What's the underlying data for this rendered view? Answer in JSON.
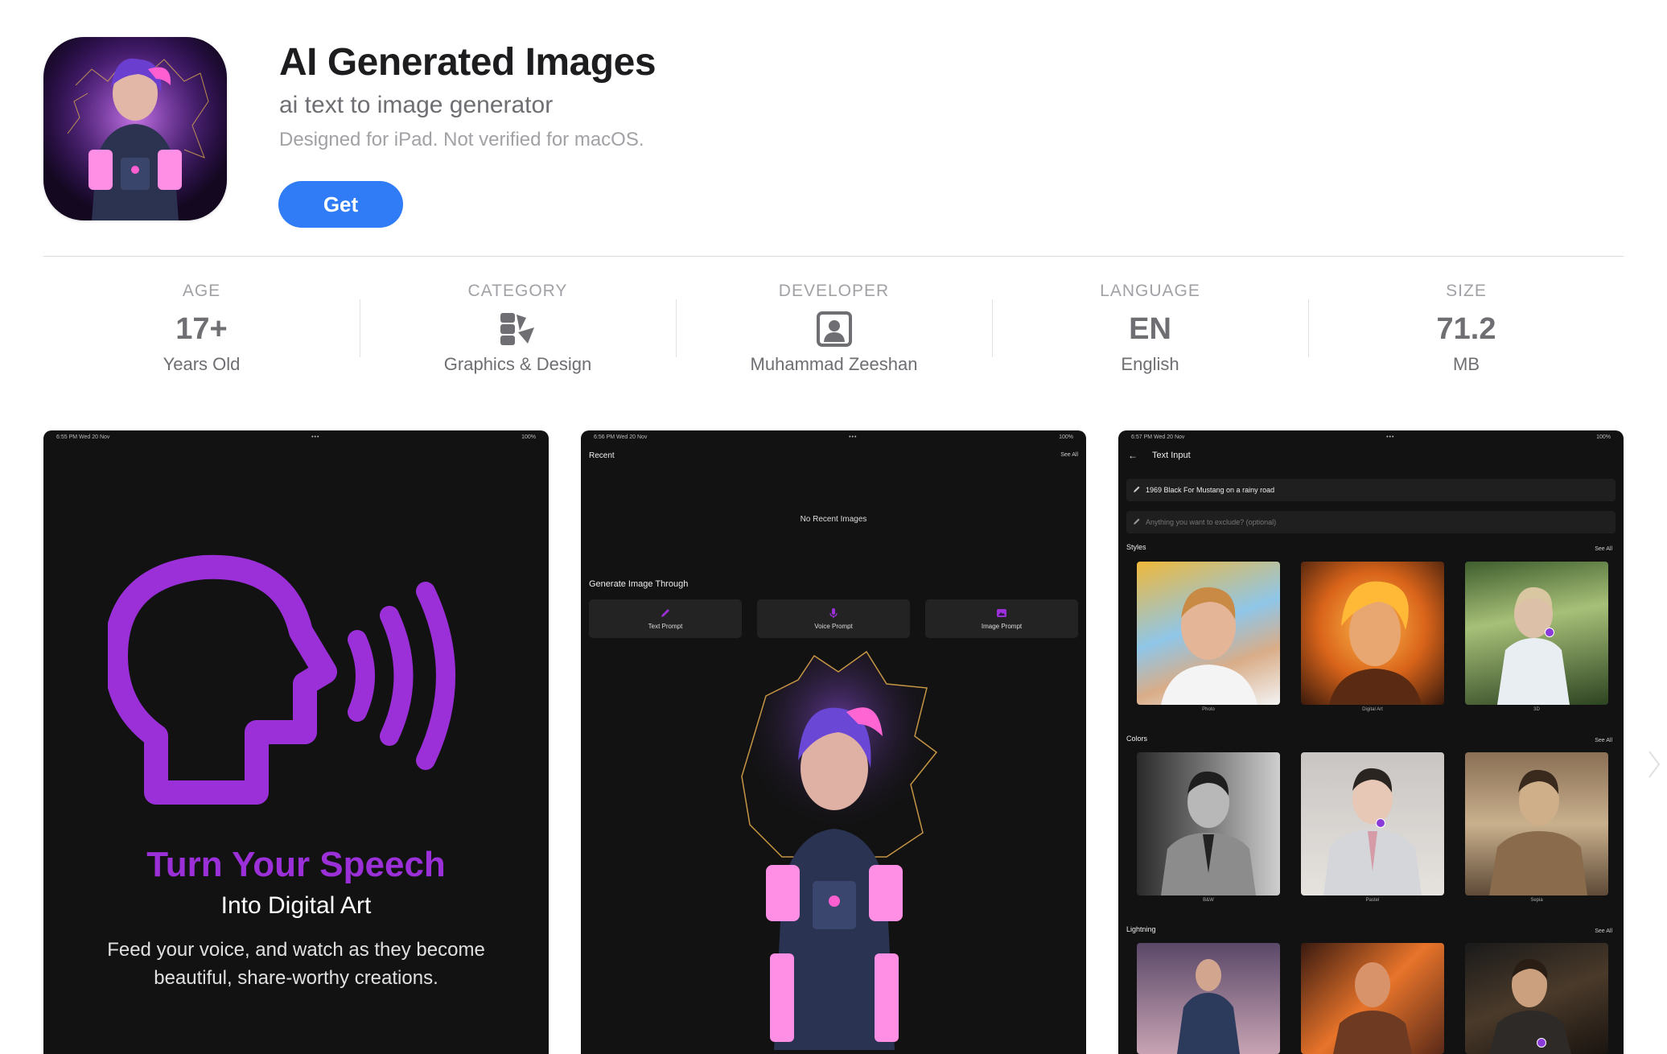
{
  "app": {
    "title": "AI Generated Images",
    "subtitle": "ai text to image generator",
    "note": "Designed for iPad. Not verified for macOS.",
    "get_label": "Get"
  },
  "info": [
    {
      "label": "AGE",
      "value": "17+",
      "sub": "Years Old"
    },
    {
      "label": "CATEGORY",
      "icon": "graphics-design-icon",
      "sub": "Graphics & Design"
    },
    {
      "label": "DEVELOPER",
      "icon": "developer-person-icon",
      "sub": "Muhammad Zeeshan"
    },
    {
      "label": "LANGUAGE",
      "value": "EN",
      "sub": "English"
    },
    {
      "label": "SIZE",
      "value": "71.2",
      "sub": "MB"
    }
  ],
  "screenshots": {
    "shot1": {
      "time": "6:55 PM   Wed 20 Nov",
      "battery": "100%",
      "headline": "Turn Your Speech",
      "subline": "Into Digital Art",
      "description": "Feed your voice, and watch as they become beautiful, share-worthy creations."
    },
    "shot2": {
      "time": "6:56 PM   Wed 20 Nov",
      "battery": "100%",
      "recent": "Recent",
      "see_all": "See All",
      "no_recent": "No Recent Images",
      "generate_through": "Generate Image Through",
      "buttons": [
        "Text Prompt",
        "Voice Prompt",
        "Image Prompt"
      ]
    },
    "shot3": {
      "time": "6:57 PM   Wed 20 Nov",
      "battery": "100%",
      "title": "Text Input",
      "prompt_value": "1969 Black For Mustang on a rainy road",
      "exclude_placeholder": "Anything you want to exclude? (optional)",
      "sections": [
        {
          "name": "Styles",
          "see_all": "See All",
          "items": [
            "Photo",
            "Digital Art",
            "3D"
          ]
        },
        {
          "name": "Colors",
          "see_all": "See All",
          "items": [
            "B&W",
            "Pastel",
            "Sepia"
          ]
        },
        {
          "name": "Lightning",
          "see_all": "See All",
          "items": [
            "",
            "",
            ""
          ]
        }
      ]
    }
  },
  "colors": {
    "accent": "#2f7cf6",
    "purple": "#9b30d9",
    "dark": "#121212"
  }
}
